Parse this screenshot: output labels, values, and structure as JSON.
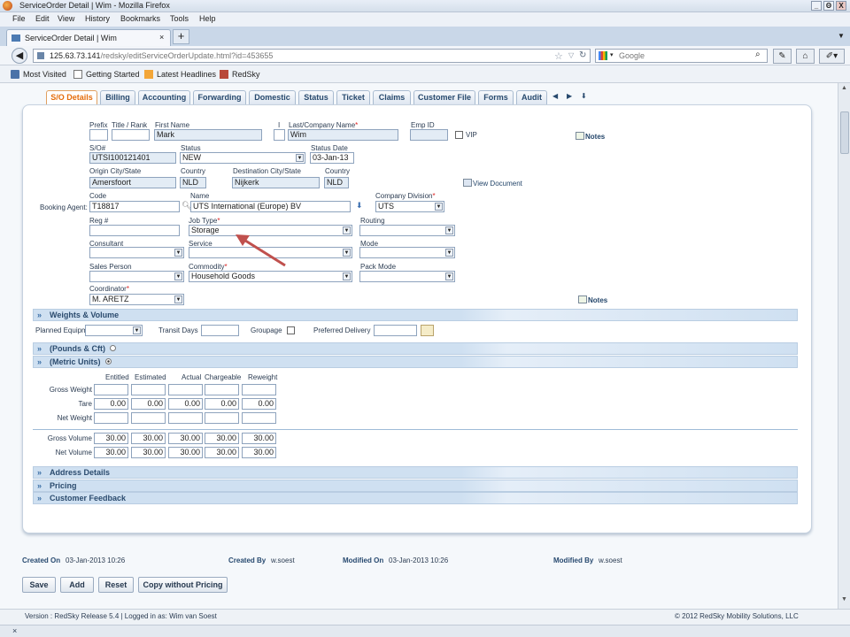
{
  "window": {
    "title": "ServiceOrder Detail | Wim - Mozilla Firefox",
    "min": "_",
    "max": "Θ",
    "close": "X"
  },
  "menu": [
    "File",
    "Edit",
    "View",
    "History",
    "Bookmarks",
    "Tools",
    "Help"
  ],
  "browser_tab": {
    "label": "ServiceOrder Detail | Wim",
    "close": "×",
    "new": "+"
  },
  "url": {
    "host": "125.63.73.141",
    "path": "/redsky/editServiceOrderUpdate.html?id=453655"
  },
  "search": {
    "placeholder": "Google"
  },
  "bookmarks": [
    "Most Visited",
    "Getting Started",
    "Latest Headlines",
    "RedSky"
  ],
  "tabs": [
    "S/O Details",
    "Billing",
    "Accounting",
    "Forwarding",
    "Domestic",
    "Status",
    "Ticket",
    "Claims",
    "Customer File",
    "Forms",
    "Audit"
  ],
  "labels": {
    "prefix": "Prefix",
    "title_rank": "Title / Rank",
    "first_name": "First Name",
    "initial": "I",
    "last_name": "Last/Company Name",
    "emp_id": "Emp ID",
    "vip": "VIP",
    "notes": "Notes",
    "so_num": "S/O#",
    "status": "Status",
    "status_date": "Status Date",
    "origin": "Origin  City/State",
    "country": "Country",
    "destination": "Destination City/State",
    "view_document": "View Document",
    "booking_agent": "Booking Agent:",
    "code": "Code",
    "name": "Name",
    "company_division": "Company Division",
    "reg": "Reg #",
    "job_type": "Job Type",
    "routing": "Routing",
    "consultant": "Consultant",
    "service": "Service",
    "mode": "Mode",
    "sales_person": "Sales Person",
    "commodity": "Commodity",
    "pack_mode": "Pack Mode",
    "coordinator": "Coordinator",
    "planned_equipment": "Planned Equipment",
    "transit_days": "Transit Days",
    "groupage": "Groupage",
    "preferred_delivery": "Preferred Delivery"
  },
  "values": {
    "first_name": "Mark",
    "last_name": "Wim",
    "so_num": "UTSI100121401",
    "status": "NEW",
    "status_date": "03-Jan-13",
    "origin": "Amersfoort",
    "origin_country": "NLD",
    "destination": "Nijkerk",
    "dest_country": "NLD",
    "code": "T18817",
    "name": "UTS International (Europe) BV",
    "company_division": "UTS",
    "job_type": "Storage",
    "commodity": "Household Goods",
    "coordinator": "M. ARETZ"
  },
  "sections": {
    "weights": "Weights & Volume",
    "pounds": "(Pounds & Cft)",
    "metric": "(Metric Units)",
    "address": "Address Details",
    "pricing": "Pricing",
    "feedback": "Customer Feedback"
  },
  "weights": {
    "columns": [
      "Entitled",
      "Estimated",
      "Actual",
      "Chargeable",
      "Reweight"
    ],
    "rows": [
      {
        "label": "Gross Weight",
        "values": [
          "",
          "",
          "",
          "",
          ""
        ]
      },
      {
        "label": "Tare",
        "values": [
          "0.00",
          "0.00",
          "0.00",
          "0.00",
          "0.00"
        ]
      },
      {
        "label": "Net Weight",
        "values": [
          "",
          "",
          "",
          "",
          ""
        ]
      },
      {
        "label": "Gross Volume",
        "values": [
          "30.00",
          "30.00",
          "30.00",
          "30.00",
          "30.00"
        ]
      },
      {
        "label": "Net Volume",
        "values": [
          "30.00",
          "30.00",
          "30.00",
          "30.00",
          "30.00"
        ]
      }
    ]
  },
  "audit": {
    "created_on_label": "Created On",
    "created_on": "03-Jan-2013 10:26",
    "created_by_label": "Created By",
    "created_by": "w.soest",
    "modified_on_label": "Modified On",
    "modified_on": "03-Jan-2013 10:26",
    "modified_by_label": "Modified By",
    "modified_by": "w.soest"
  },
  "buttons": [
    "Save",
    "Add",
    "Reset",
    "Copy without Pricing"
  ],
  "status_bar": {
    "version": "Version : RedSky Release 5.4 | Logged in as: Wim van Soest",
    "copyright": "© 2012 RedSky Mobility Solutions, LLC"
  },
  "addon_bar": {
    "close": "×"
  },
  "colors": {
    "active_tab": "#e46c0a",
    "section_bar": "#cfe0f1",
    "annotation_arrow": "#c0504d",
    "required": "#dd2222"
  }
}
